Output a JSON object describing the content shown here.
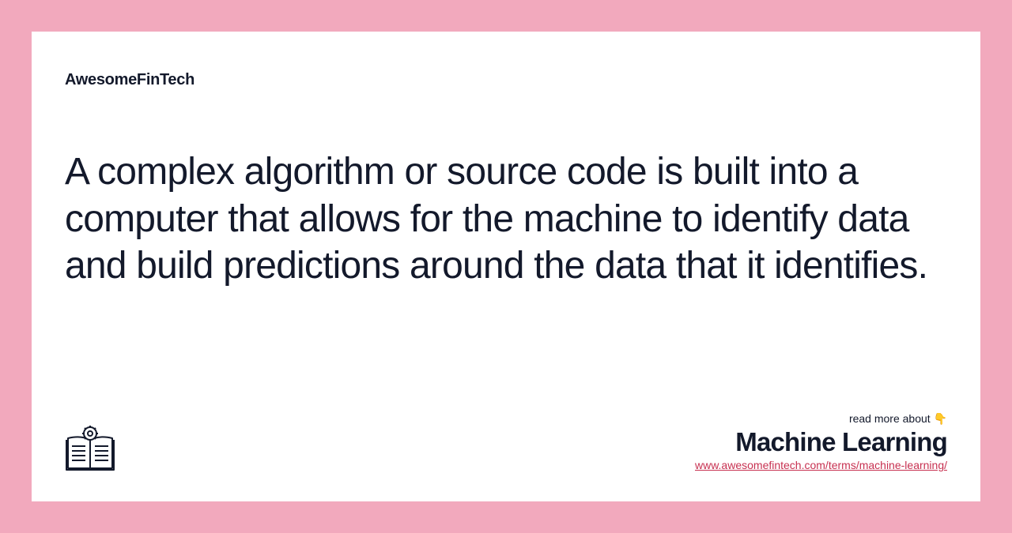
{
  "brand": "AwesomeFinTech",
  "description": "A complex algorithm or source code is built into a computer that allows for the machine to identify data and build predictions around the data that it identifies.",
  "footer": {
    "readMore": "read more about 👇",
    "title": "Machine Learning",
    "link": "www.awesomefintech.com/terms/machine-learning/"
  }
}
